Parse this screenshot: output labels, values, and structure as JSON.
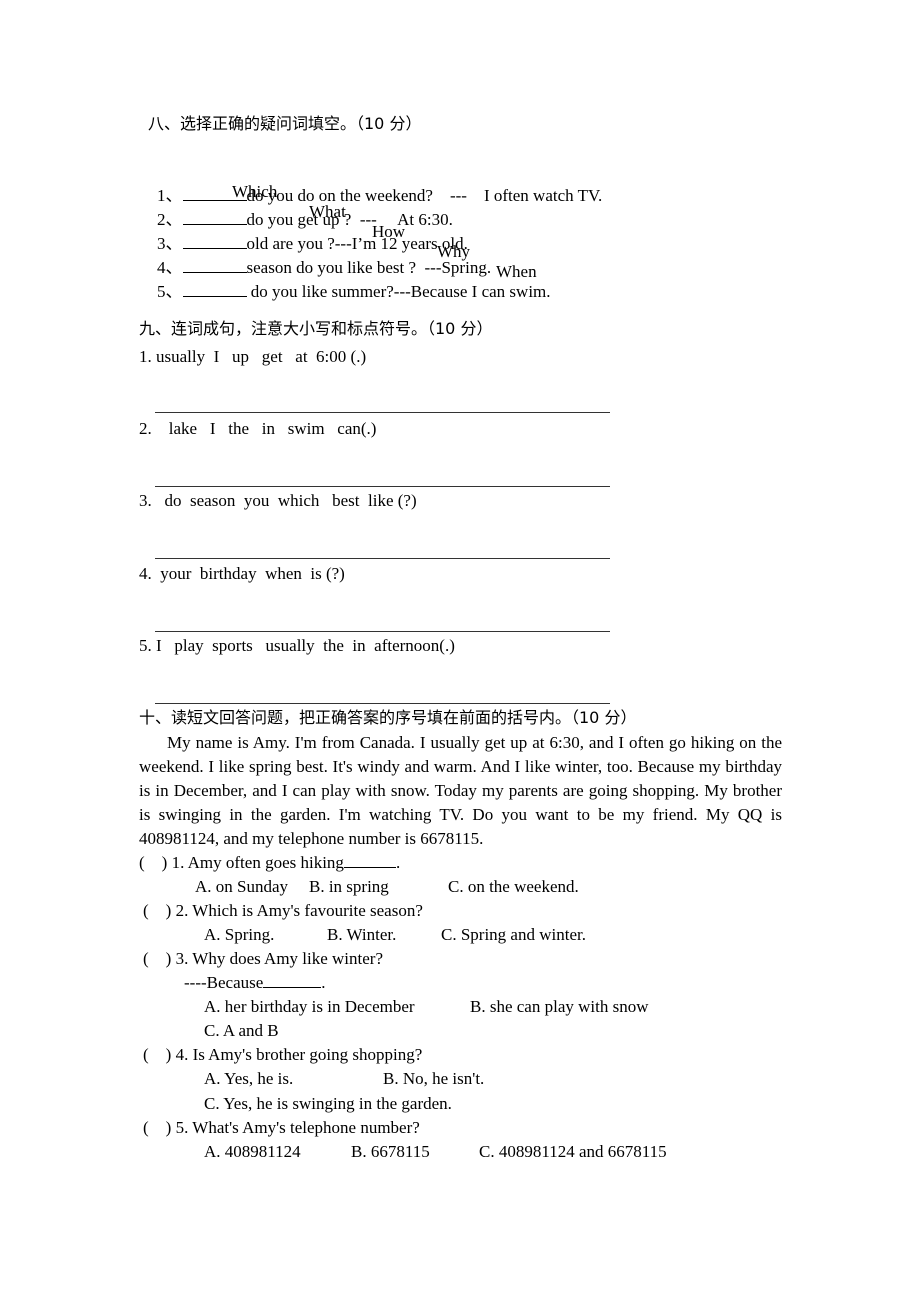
{
  "section8": {
    "title": "八、选择正确的疑问词填空。（10 分）",
    "word_bank": [
      "Which",
      "What",
      "How",
      "Why",
      "When"
    ],
    "items": [
      {
        "num": "1、",
        "text": "do you do on the weekend?    ---    I often watch TV."
      },
      {
        "num": "2、",
        "text": "do you get up ?  ---     At 6:30."
      },
      {
        "num": "3、",
        "text": "old are you ?---I’m 12 years old."
      },
      {
        "num": "4、",
        "text": "season do you like best ?  ---Spring."
      },
      {
        "num": "5、",
        "text": " do you like summer?---Because I can swim."
      }
    ]
  },
  "section9": {
    "title": "九、连词成句，注意大小写和标点符号。（10 分）",
    "items": [
      {
        "text": "1. usually  I   up   get   at  6:00 (.)"
      },
      {
        "text": "2.    lake   I   the   in   swim   can(.)"
      },
      {
        "text": "3.   do  season  you  which   best  like (?)"
      },
      {
        "text": "4.  your  birthday  when  is (?)"
      },
      {
        "text": "5. I   play  sports   usually  the  in  afternoon(.)"
      }
    ]
  },
  "section10": {
    "title": "十、读短文回答问题，把正确答案的序号填在前面的括号内。（10 分）",
    "passage": "My name is Amy. I'm from Canada. I usually get up at 6:30, and I often go hiking on the weekend. I like spring best. It's windy and warm. And I like winter, too. Because my birthday is in December, and I can play with snow. Today my parents are going shopping. My brother is swinging in the garden. I'm watching TV. Do you want to be my friend. My QQ is 408981124, and my telephone number is 6678115.",
    "questions": [
      {
        "bracket": "(    )",
        "q": "1. Amy often goes hiking",
        "blank_after": true,
        "tail": ".",
        "options": [
          "A. on Sunday",
          "B. in spring",
          "C. on the weekend."
        ]
      },
      {
        "bracket": "(    )",
        "q": "2. Which is Amy's favourite season?",
        "options": [
          "A. Spring.",
          "B. Winter.",
          "C. Spring and winter."
        ]
      },
      {
        "bracket": "(    )",
        "q": "3. Why does Amy like winter?",
        "sub": "----Because",
        "sub_tail": ".",
        "options": [
          "A. her birthday is in December",
          "B. she can play with snow",
          "C. A and B"
        ]
      },
      {
        "bracket": "(    )",
        "q": "4. Is Amy's brother going shopping?",
        "options": [
          "A. Yes, he is.",
          "B. No, he isn't.",
          "C. Yes, he is swinging in the garden."
        ]
      },
      {
        "bracket": "(    )",
        "q": "5. What's Amy's telephone number?",
        "options": [
          "A. 408981124",
          "B. 6678115",
          "C. 408981124 and 6678115"
        ]
      }
    ]
  }
}
